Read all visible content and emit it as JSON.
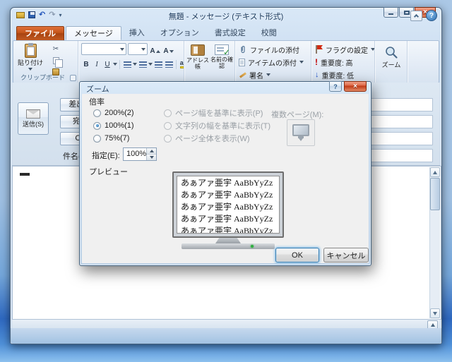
{
  "window": {
    "title": "無題 - メッセージ (テキスト形式)"
  },
  "tabs": [
    {
      "label": "ファイル"
    },
    {
      "label": "メッセージ",
      "selected": true
    },
    {
      "label": "挿入"
    },
    {
      "label": "オプション"
    },
    {
      "label": "書式設定"
    },
    {
      "label": "校閲"
    }
  ],
  "ribbon": {
    "paste": "貼り付け",
    "clipboard_group": "クリップボード",
    "font": {
      "bold": "B",
      "italic": "I",
      "underline": "U",
      "letter": "A",
      "highlight": "ab",
      "color": "A"
    },
    "address_book": "アドレス帳",
    "check_names": "名前の確認",
    "attach_file": "ファイルの添付",
    "attach_item": "アイテムの添付",
    "signature": "署名",
    "flag": "フラグの設定",
    "importance_high": "重要度: 高",
    "importance_low": "重要度: 低",
    "zoom": "ズーム"
  },
  "compose": {
    "send": "送信(S)",
    "from": "差出人(M)",
    "to": "宛先(O)",
    "cc": "CC(C)",
    "subject": "件名(U):",
    "from_value": "",
    "subject_value": ""
  },
  "dialog": {
    "title": "ズーム",
    "magnification": "倍率",
    "zoom_options": [
      {
        "label": "200%(2)",
        "selected": false
      },
      {
        "label": "100%(1)",
        "selected": true
      },
      {
        "label": "75%(7)",
        "selected": false
      }
    ],
    "fit_options": [
      {
        "label": "ページ幅を基準に表示(P)",
        "enabled": false
      },
      {
        "label": "文字列の幅を基準に表示(T)",
        "enabled": false
      },
      {
        "label": "ページ全体を表示(W)",
        "enabled": false
      }
    ],
    "many_pages": "複数ページ(M):",
    "percent_label": "指定(E):",
    "percent_value": "100%",
    "preview_label": "プレビュー",
    "preview_lines": [
      "あぁアァ亜宇 AaBbYyZz",
      "あぁアァ亜宇 AaBbYyZz",
      "あぁアァ亜宇 AaBbYyZz",
      "あぁアァ亜宇 AaBbYyZz",
      "あぁアァ亜宇 AaBbYyZz"
    ],
    "ok": "OK",
    "cancel": "キャンセル"
  },
  "colors": {
    "accent_orange": "#c35419",
    "aero_blue": "#cfe0f2",
    "close_red": "#c13a17",
    "selection_blue": "#1f5f9f"
  }
}
